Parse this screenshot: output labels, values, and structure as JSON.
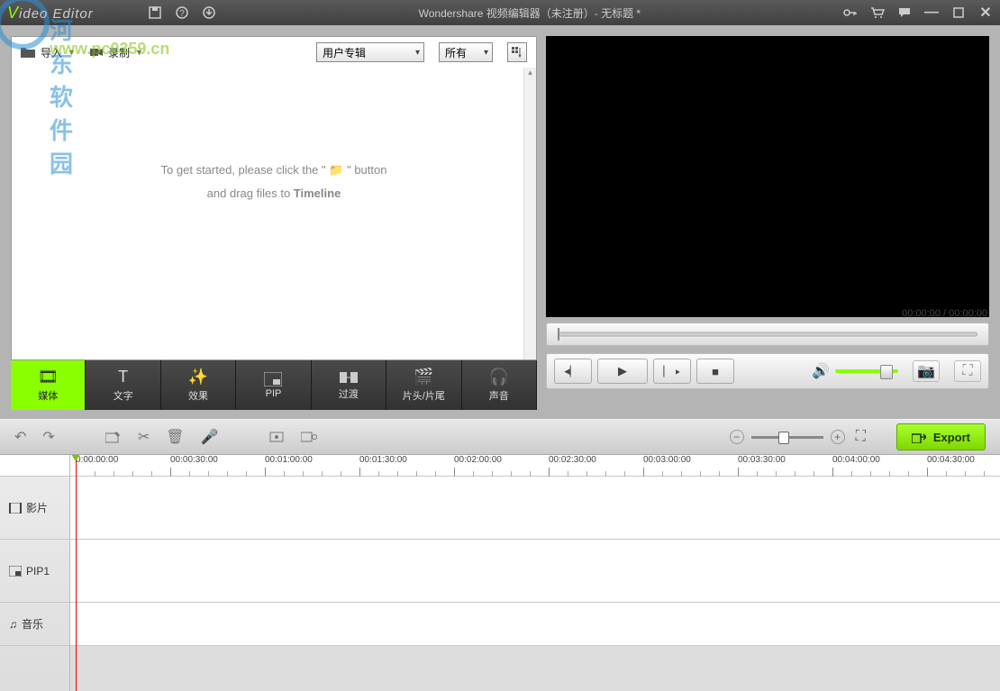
{
  "app": {
    "logo_prefix": "V",
    "logo_rest": "ideo Editor"
  },
  "title": "Wondershare 视频编辑器（未注册）- 无标题 *",
  "watermark": {
    "line1": "河东软件园",
    "line2": "www.pc0359.cn"
  },
  "media": {
    "import_label": "导入",
    "record_label": "录制",
    "select1": "用户专辑",
    "select2": "所有",
    "empty_line1a": "To get started, please click the \"",
    "empty_line1b": "\" button",
    "empty_line2a": "and drag files to ",
    "empty_line2b": "Timeline"
  },
  "cats": {
    "media": "媒体",
    "text": "文字",
    "effect": "效果",
    "pip": "PIP",
    "transition": "过渡",
    "introoutro": "片头/片尾",
    "sound": "声音"
  },
  "preview": {
    "time_current": "00:00:00",
    "time_total": "00:00:00"
  },
  "export_label": "Export",
  "ruler_ticks": [
    "0:00:00:00",
    "00:00:30:00",
    "00:01:00:00",
    "00:01:30:00",
    "00:02:00:00",
    "00:02:30:00",
    "00:03:00:00",
    "00:03:30:00",
    "00:04:00:00",
    "00:04:30:00"
  ],
  "tracks": {
    "video": "影片",
    "pip": "PIP1",
    "music": "音乐"
  }
}
